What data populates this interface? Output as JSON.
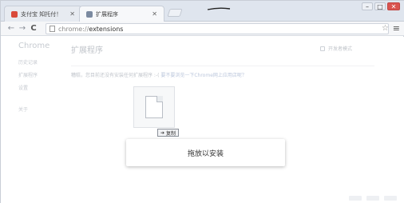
{
  "window": {
    "tabs": [
      {
        "title": "支付宝 知托付！",
        "icon": "alipay-icon",
        "active": false
      },
      {
        "title": "扩展程序",
        "icon": "puzzle-icon",
        "active": true
      }
    ],
    "controls": {
      "minimize": "–",
      "maximize": "□",
      "close": "✕"
    }
  },
  "toolbar": {
    "back_glyph": "←",
    "forward_glyph": "→",
    "reload_glyph": "C",
    "url_scheme": "chrome://",
    "url_path": "extensions",
    "star_glyph": "☆",
    "menu_glyph": "≡"
  },
  "sidebar": {
    "brand": "Chrome",
    "items": [
      "历史记录",
      "扩展程序",
      "设置"
    ],
    "about": "关于"
  },
  "main": {
    "title": "扩展程序",
    "dev_mode_label": "开发者模式",
    "hint_text": "糟糕，您目前还没有安装任何扩展程序 :-(",
    "hint_link": "要不要浏览一下Chrome网上应用店呢？"
  },
  "drag": {
    "badge_glyph": "➔",
    "badge_label": "复制"
  },
  "dropzone": {
    "label": "拖放以安装"
  }
}
